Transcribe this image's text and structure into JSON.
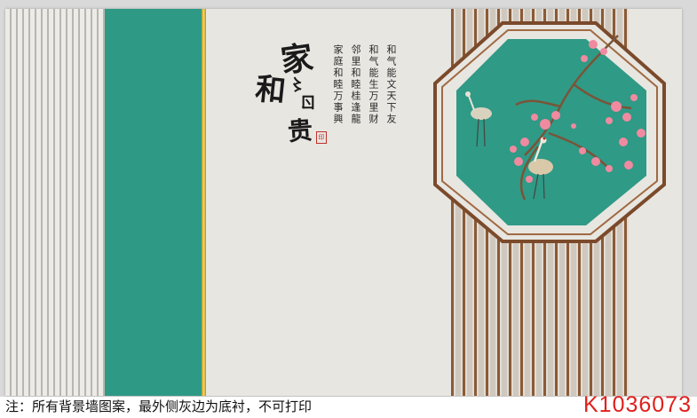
{
  "calligraphy": {
    "chars": [
      "家",
      "和",
      "〻",
      "ㄖ",
      "贵"
    ],
    "seal": "印"
  },
  "poem": {
    "columns": [
      "和气能文天下友",
      "和气能生万里财",
      "邻里和睦桂逢龍",
      "家庭和睦万事興"
    ]
  },
  "footer": {
    "note": "注：所有背景墙图案，最外侧灰边为底衬，不可打印",
    "code": "K1036073"
  },
  "colors": {
    "teal": "#2e9a86",
    "gold": "#e0c24a",
    "wood": "#7b4a2b",
    "blossom": "#f08aa0",
    "code_red": "#e0201c"
  },
  "icons": [
    "crane-icon",
    "plum-blossom-icon"
  ]
}
